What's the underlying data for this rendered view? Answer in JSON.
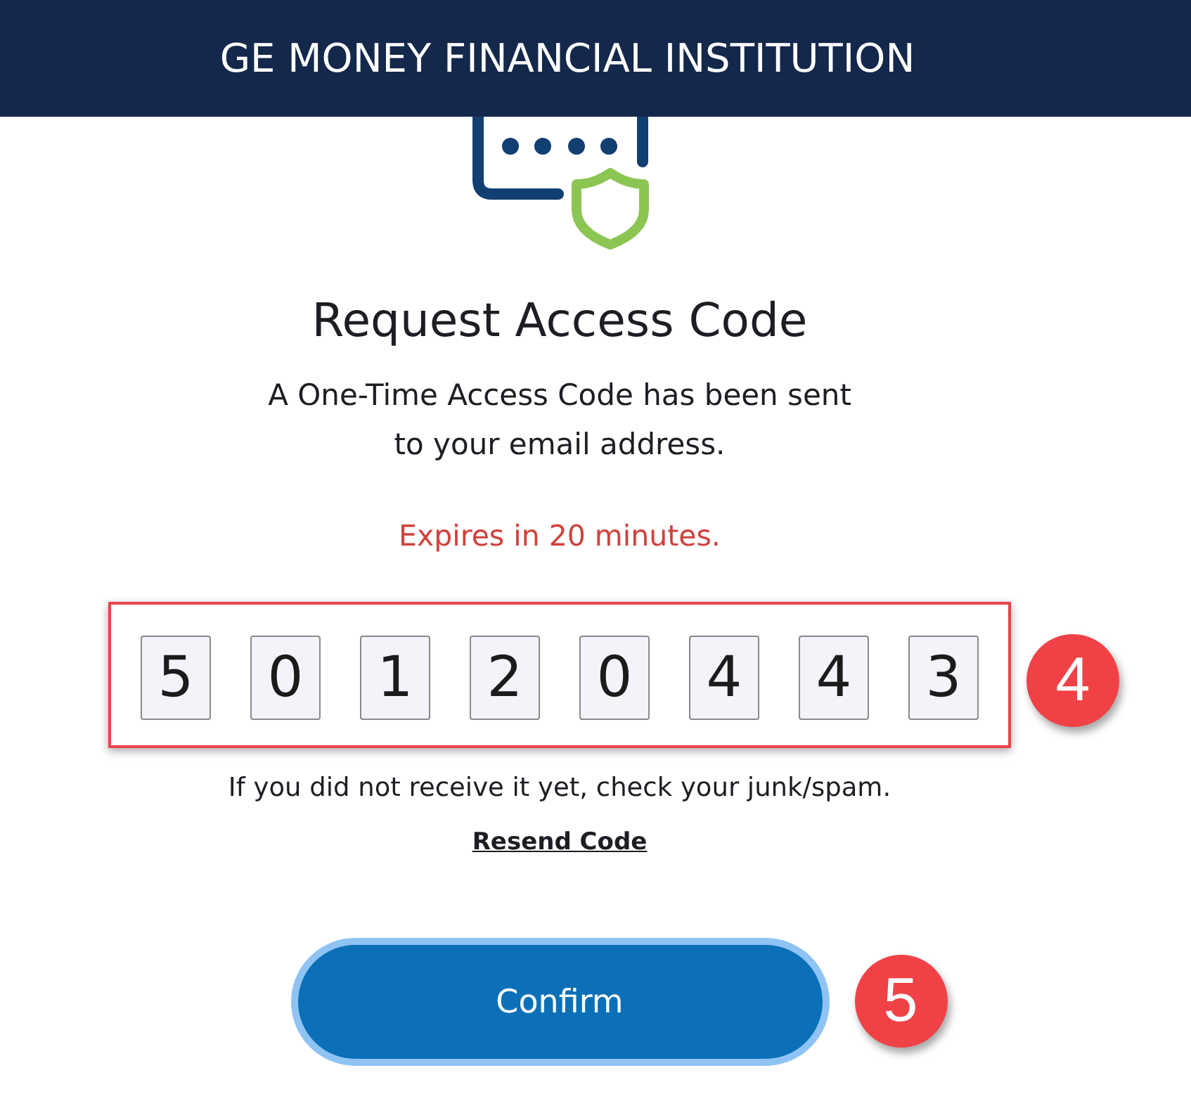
{
  "header": {
    "title": "GE MONEY FINANCIAL INSTITUTION"
  },
  "content": {
    "heading": "Request Access Code",
    "message": "A One-Time Access Code has been sent to your email address.",
    "expiry": "Expires in 20 minutes.",
    "code_digits": [
      "5",
      "0",
      "1",
      "2",
      "0",
      "4",
      "4",
      "3"
    ],
    "hint": "If you did not receive it yet, check your junk/spam.",
    "resend_link": "Resend Code",
    "confirm_button": "Confirm"
  },
  "callouts": [
    {
      "label": "4"
    },
    {
      "label": "5"
    }
  ]
}
